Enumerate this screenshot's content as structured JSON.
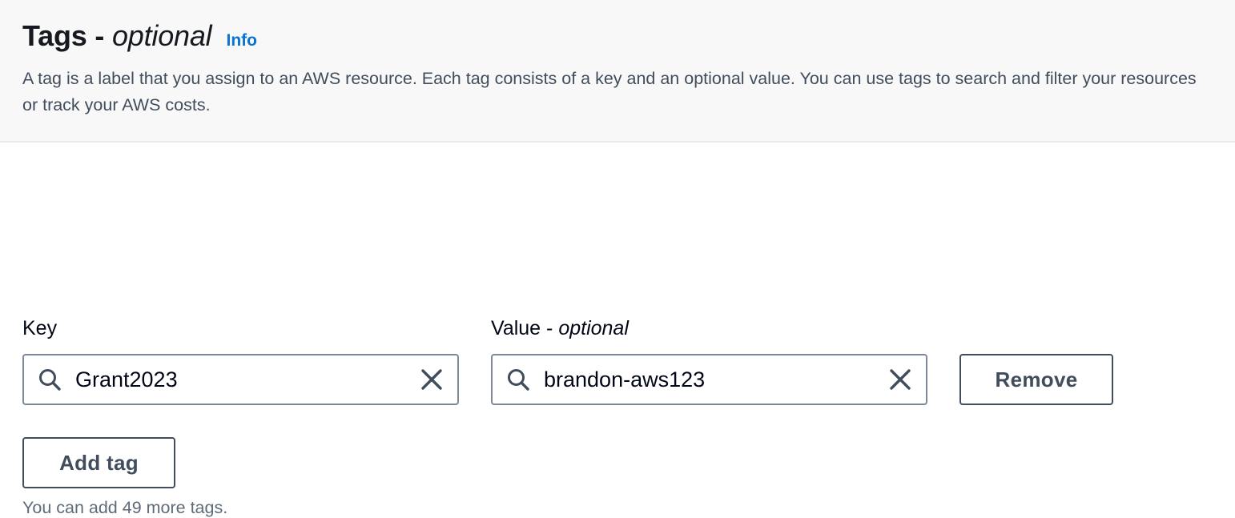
{
  "section": {
    "title_main": "Tags",
    "title_sep": " - ",
    "title_optional": "optional",
    "info_label": "Info",
    "description": "A tag is a label that you assign to an AWS resource. Each tag consists of a key and an optional value. You can use tags to search and filter your resources or track your AWS costs."
  },
  "tags": {
    "key_label": "Key",
    "value_label_main": "Value - ",
    "value_label_optional": "optional",
    "rows": [
      {
        "key": "Grant2023",
        "value": "brandon-aws123",
        "remove_label": "Remove"
      }
    ],
    "add_tag_label": "Add tag",
    "remaining_hint": "You can add 49 more tags."
  },
  "icons": {
    "search": "search-icon",
    "clear": "close-icon"
  },
  "colors": {
    "header_bg": "#f8f8f9",
    "link": "#0972d3",
    "border": "#7d8998",
    "button_text": "#414d5c",
    "muted_text": "#5f6b7a"
  }
}
